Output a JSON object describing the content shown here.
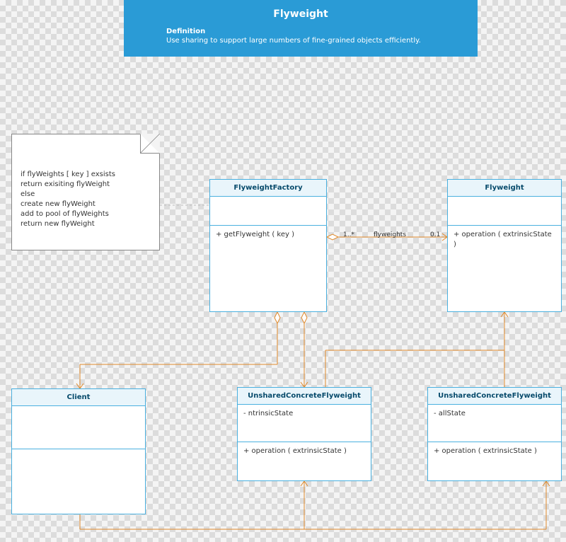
{
  "header": {
    "title": "Flyweight",
    "definition_label": "Definition",
    "definition_text": "Use sharing to support large numbers of fine-grained objects efficiently."
  },
  "note": {
    "line1": "if flyWeights [ key ] exsists",
    "line2": "return exisiting flyWeight",
    "line3": "else",
    "line4": "create new flyWeight",
    "line5": "add to pool of flyWeights",
    "line6": "return new flyWeight"
  },
  "classes": {
    "factory": {
      "name": "FlyweightFactory",
      "method1": "+ getFlyweight ( key )"
    },
    "flyweight": {
      "name": "Flyweight",
      "method1": "+ operation ( extrinsicState )"
    },
    "client": {
      "name": "Client"
    },
    "unshared1": {
      "name": "UnsharedConcreteFlyweight",
      "attr1": "- ntrinsicState",
      "method1": "+ operation ( extrinsicState )"
    },
    "unshared2": {
      "name": "UnsharedConcreteFlyweight",
      "attr1": "- allState",
      "method1": "+ operation ( extrinsicState )"
    }
  },
  "assoc": {
    "left_mult": "1..*",
    "name": "flyweights",
    "right_mult": "0.1"
  }
}
